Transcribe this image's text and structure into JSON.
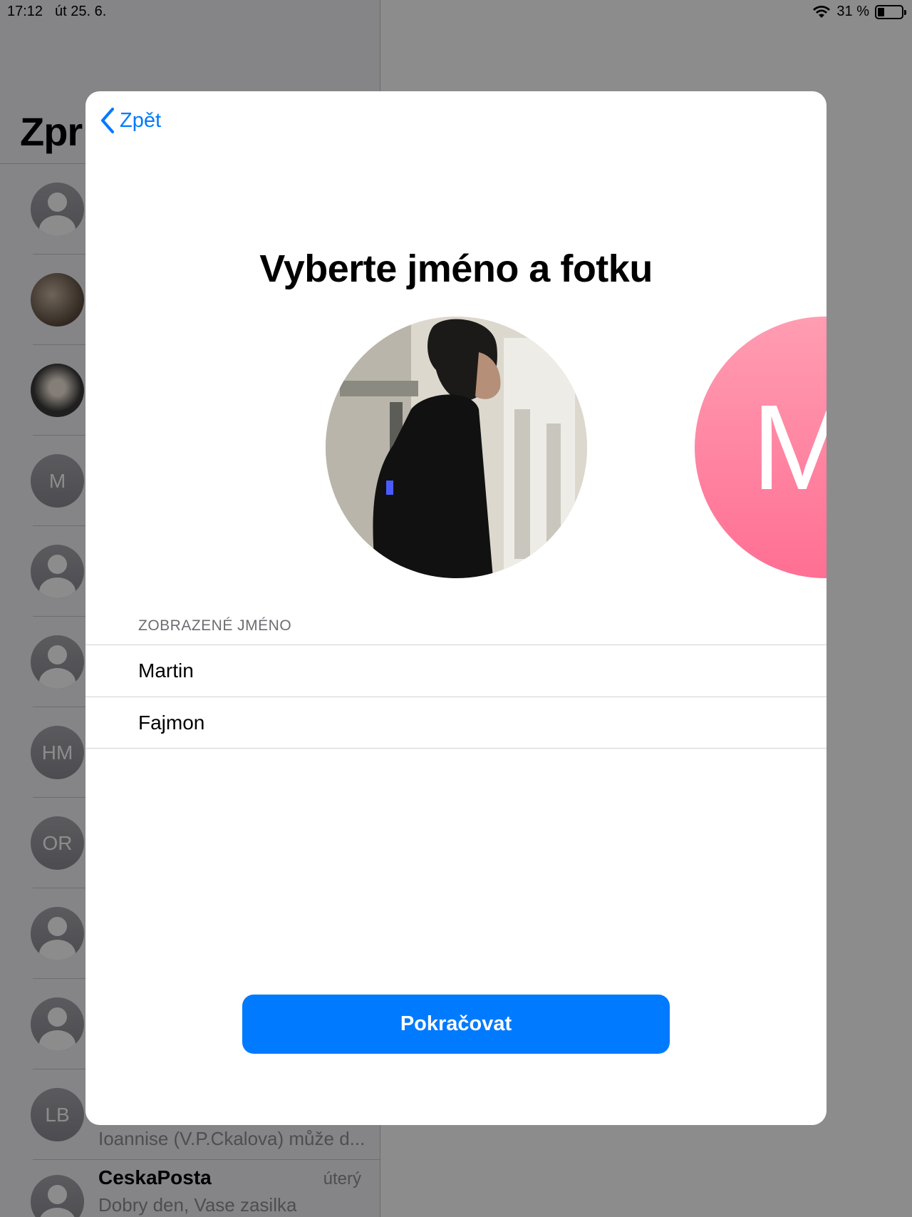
{
  "status_bar": {
    "time": "17:12",
    "date": "út 25. 6.",
    "battery": "31 %"
  },
  "sidebar": {
    "title": "Zpr",
    "avatars": [
      "",
      "",
      "",
      "M",
      "",
      "",
      "HM",
      "OR",
      "",
      "",
      "LB"
    ],
    "partial_preview": "Ioannise (V.P.Ckalova) může d...",
    "last_conversation": {
      "name": "CeskaPosta",
      "date": "úterý",
      "preview": "Dobry den, Vase zasilka"
    }
  },
  "modal": {
    "back_label": "Zpět",
    "title": "Vyberte jméno a fotku",
    "monogram_letter": "M",
    "section_label": "ZOBRAZENÉ JMÉNO",
    "first_name": "Martin",
    "last_name": "Fajmon",
    "continue_label": "Pokračovat"
  },
  "colors": {
    "accent": "#007aff",
    "monogram": "#ff7a9a",
    "dim_overlay": "#8e8e93"
  }
}
